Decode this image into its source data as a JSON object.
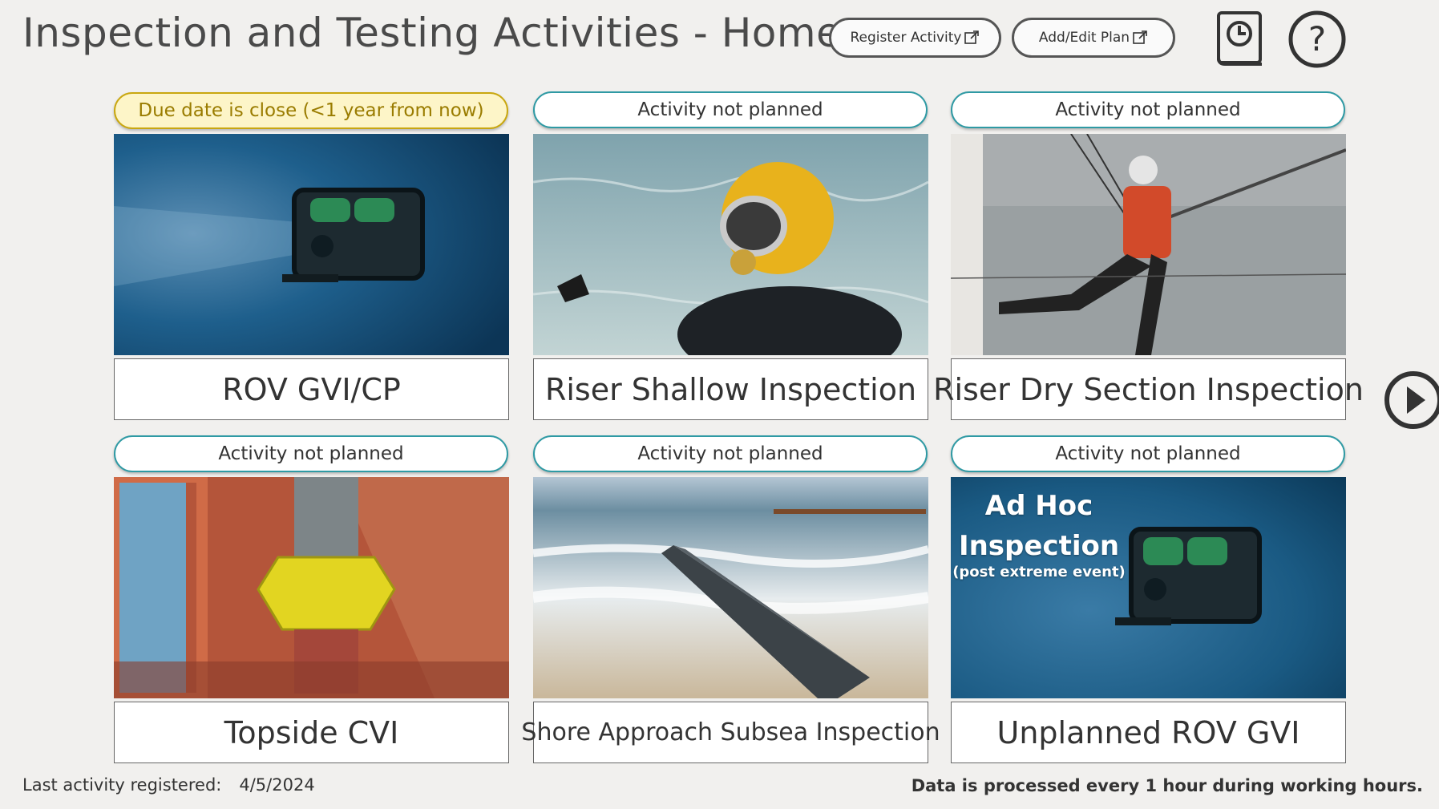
{
  "header": {
    "title": "Inspection and Testing Activities - Home",
    "register_button": "Register Activity",
    "edit_plan_button": "Add/Edit Plan"
  },
  "cards": [
    {
      "status": "Due date is close (<1 year from now)",
      "status_type": "warning",
      "label": "ROV GVI/CP"
    },
    {
      "status": "Activity not planned",
      "status_type": "normal",
      "label": "Riser Shallow Inspection"
    },
    {
      "status": "Activity not planned",
      "status_type": "normal",
      "label": "Riser Dry Section Inspection"
    },
    {
      "status": "Activity not planned",
      "status_type": "normal",
      "label": "Topside CVI"
    },
    {
      "status": "Activity not planned",
      "status_type": "normal",
      "label": "Shore Approach Subsea Inspection"
    },
    {
      "status": "Activity not planned",
      "status_type": "normal",
      "label": "Unplanned ROV GVI"
    }
  ],
  "adhoc_overlay": {
    "line1": "Ad Hoc",
    "line2": "Inspection",
    "line3": "(post extreme event)"
  },
  "footer": {
    "last_label": "Last activity registered:",
    "last_date": "4/5/2024",
    "processing_note": "Data is processed every 1 hour during working hours."
  },
  "icons": {
    "history": "history-book-icon",
    "help": "help-question-icon",
    "next": "next-page-icon",
    "external": "external-link-icon"
  },
  "colors": {
    "accent": "#2f9aa4",
    "warning_bg": "#fdf5c8",
    "warning_border": "#c9a70f",
    "background": "#f1f0ee"
  }
}
